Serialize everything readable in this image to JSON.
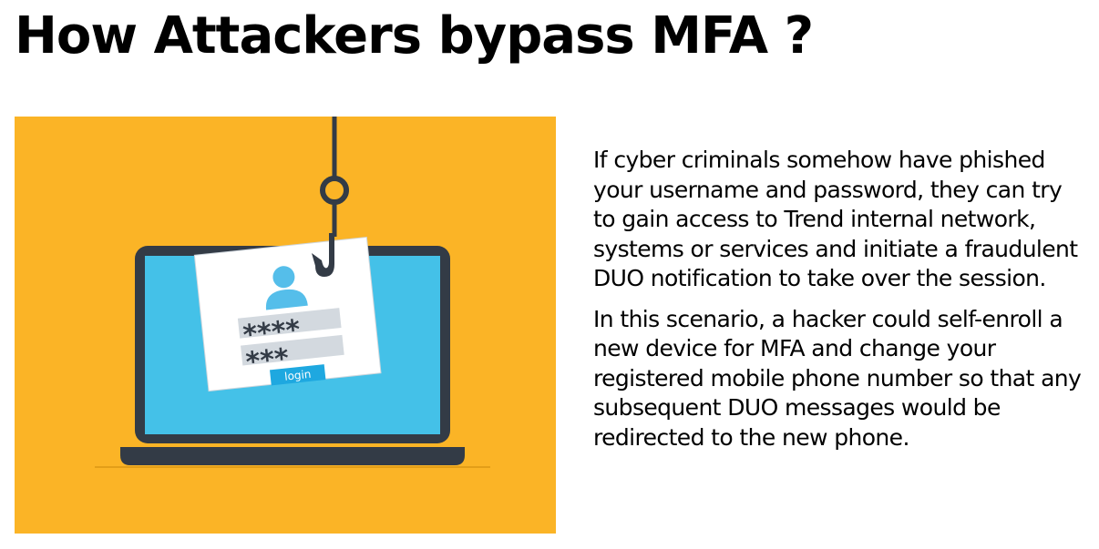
{
  "slide": {
    "title": "How Attackers bypass MFA ?"
  },
  "illustration": {
    "password_mask_1": "****",
    "password_mask_2": "***",
    "login_button_label": "login",
    "colors": {
      "background": "#FBB426",
      "screen": "#44C1E8",
      "laptop_frame": "#333B46",
      "avatar": "#55BEEA",
      "field": "#D3D9DF",
      "button": "#1EA8E0"
    }
  },
  "body": {
    "paragraph_1": "If cyber criminals somehow have phished your username and password, they can try to gain access to Trend internal network, systems or services and initiate a fraudulent DUO notification to take over the session.",
    "paragraph_2": "In this scenario, a hacker could self-enroll a new device for MFA and change your registered mobile phone number so that any subsequent DUO messages would be redirected to the new phone."
  }
}
